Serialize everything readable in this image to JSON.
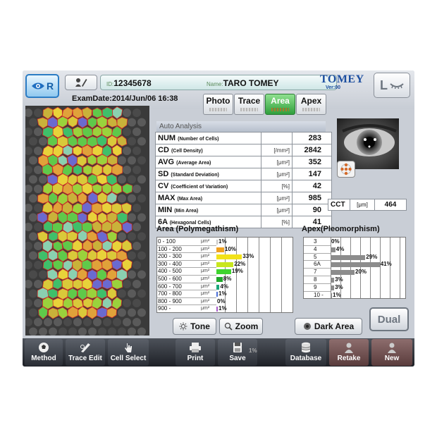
{
  "header": {
    "eye_side": "R",
    "id_label": "ID:",
    "id_value": "12345678",
    "name_label": "Name:",
    "name_value": "TARO TOMEY",
    "brand": "TOMEY",
    "version": "Ver:00",
    "other_eye": "L",
    "exam_date": "ExamDate:2014/Jun/06 16:38"
  },
  "tabs": [
    {
      "label": "Photo",
      "active": false
    },
    {
      "label": "Trace",
      "active": false
    },
    {
      "label": "Area",
      "active": true
    },
    {
      "label": "Apex",
      "active": false
    }
  ],
  "auto_analysis": {
    "title": "Auto Analysis",
    "rows": [
      {
        "name": "NUM",
        "desc": "(Number of Cells)",
        "unit": "",
        "value": "283"
      },
      {
        "name": "CD",
        "desc": "(Cell Density)",
        "unit": "[/mm²]",
        "value": "2842"
      },
      {
        "name": "AVG",
        "desc": "(Average Area)",
        "unit": "[μm²]",
        "value": "352"
      },
      {
        "name": "SD",
        "desc": "(Standard Deviation)",
        "unit": "[μm²]",
        "value": "147"
      },
      {
        "name": "CV",
        "desc": "(Coefficient of Variation)",
        "unit": "[%]",
        "value": "42"
      },
      {
        "name": "MAX",
        "desc": "(Max Area)",
        "unit": "[μm²]",
        "value": "985"
      },
      {
        "name": "MIN",
        "desc": "(Min Area)",
        "unit": "[μm²]",
        "value": "90"
      },
      {
        "name": "6A",
        "desc": "(Hexagonal Cells)",
        "unit": "[%]",
        "value": "41"
      }
    ]
  },
  "cct": {
    "label": "CCT",
    "unit": "[μm]",
    "value": "464"
  },
  "polymegathism": {
    "title": "Area (Polymegathism)",
    "unit": "μm²",
    "rows": [
      {
        "range": "0 - 100",
        "percent": 1,
        "label": "1%",
        "color": "#c8c8c8"
      },
      {
        "range": "100 - 200",
        "percent": 10,
        "label": "10%",
        "color": "#f0a020"
      },
      {
        "range": "200 - 300",
        "percent": 33,
        "label": "33%",
        "color": "#f2e21a"
      },
      {
        "range": "300 - 400",
        "percent": 22,
        "label": "22%",
        "color": "#c8e61e"
      },
      {
        "range": "400 - 500",
        "percent": 19,
        "label": "19%",
        "color": "#3fd42f"
      },
      {
        "range": "500 - 600",
        "percent": 8,
        "label": "8%",
        "color": "#1fa72a"
      },
      {
        "range": "600 - 700",
        "percent": 4,
        "label": "4%",
        "color": "#1aa67a"
      },
      {
        "range": "700 - 800",
        "percent": 1,
        "label": "1%",
        "color": "#4b6fd6"
      },
      {
        "range": "800 - 900",
        "percent": 0,
        "label": "0%",
        "color": "#7a50c8"
      },
      {
        "range": "900 -",
        "percent": 1,
        "label": "1%",
        "color": "#a85ac8"
      }
    ]
  },
  "pleomorphism": {
    "title": "Apex(Pleomorphism)",
    "rows": [
      {
        "sides": "3",
        "percent": 0,
        "label": "0%"
      },
      {
        "sides": "4",
        "percent": 4,
        "label": "4%"
      },
      {
        "sides": "5",
        "percent": 29,
        "label": "29%"
      },
      {
        "sides": "6A",
        "percent": 41,
        "label": "41%"
      },
      {
        "sides": "7",
        "percent": 20,
        "label": "20%"
      },
      {
        "sides": "8",
        "percent": 3,
        "label": "3%"
      },
      {
        "sides": "9",
        "percent": 3,
        "label": "3%"
      },
      {
        "sides": "10 -",
        "percent": 1,
        "label": "1%"
      }
    ]
  },
  "buttons": {
    "tone": "Tone",
    "zoom": "Zoom",
    "dark_area": "Dark Area",
    "dual": "Dual"
  },
  "toolbar": {
    "method": "Method",
    "trace_edit": "Trace Edit",
    "cell_select": "Cell Select",
    "print": "Print",
    "save": "Save",
    "save_badge": "1%",
    "database": "Database",
    "retake": "Retake",
    "new": "New"
  }
}
